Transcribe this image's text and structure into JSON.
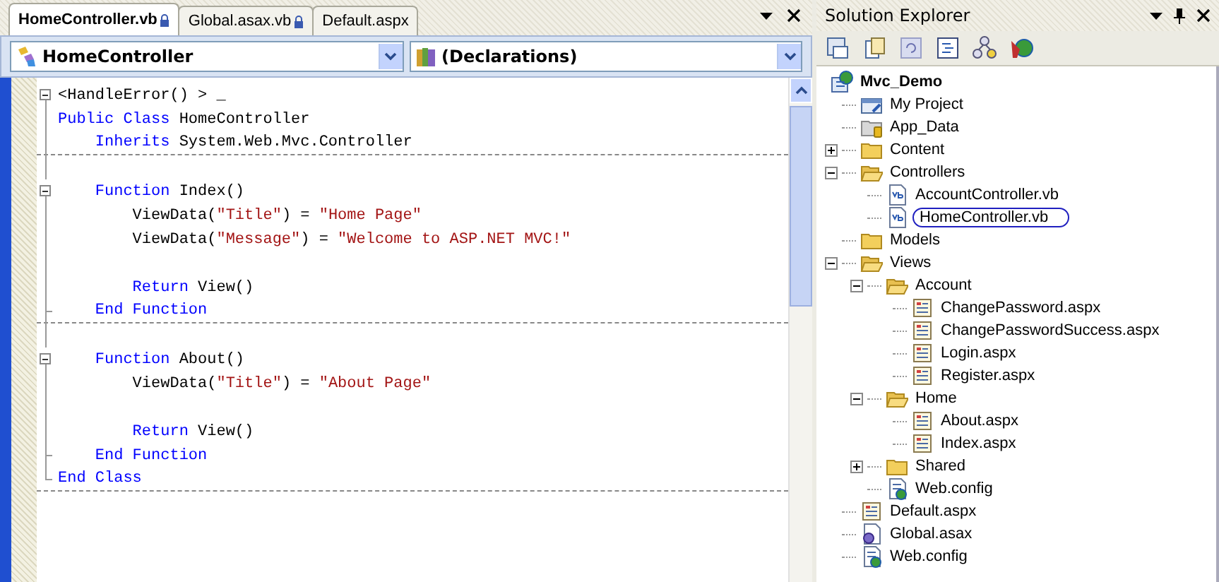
{
  "editor": {
    "tabs": [
      {
        "label": "HomeController.vb",
        "selected": true,
        "locked": true
      },
      {
        "label": "Global.asax.vb",
        "selected": false,
        "locked": true
      },
      {
        "label": "Default.aspx",
        "selected": false,
        "locked": false
      }
    ],
    "class_dropdown": {
      "value": "HomeController"
    },
    "member_dropdown": {
      "value": "(Declarations)"
    },
    "lines": [
      {
        "kind": "fold-start",
        "separator": false,
        "tokens": [
          {
            "kind": "plain",
            "text": "<HandleError() > _"
          }
        ]
      },
      {
        "kind": "fold-line",
        "separator": false,
        "tokens": [
          {
            "kind": "keyword",
            "text": "Public Class"
          },
          {
            "kind": "plain",
            "text": " HomeController"
          }
        ]
      },
      {
        "kind": "fold-line",
        "separator": true,
        "tokens": [
          {
            "kind": "keyword",
            "text": "    Inherits"
          },
          {
            "kind": "plain",
            "text": " System.Web.Mvc.Controller"
          }
        ]
      },
      {
        "kind": "fold-line"
      },
      {
        "kind": "fold-start",
        "separator": false,
        "tokens": [
          {
            "kind": "keyword",
            "text": "    Function"
          },
          {
            "kind": "plain",
            "text": " Index()"
          }
        ]
      },
      {
        "kind": "fold-line",
        "separator": false,
        "tokens": [
          {
            "kind": "plain",
            "text": "        ViewData("
          },
          {
            "kind": "string",
            "text": "\"Title\""
          },
          {
            "kind": "plain",
            "text": ") = "
          },
          {
            "kind": "string",
            "text": "\"Home Page\""
          }
        ]
      },
      {
        "kind": "fold-line",
        "separator": false,
        "tokens": [
          {
            "kind": "plain",
            "text": "        ViewData("
          },
          {
            "kind": "string",
            "text": "\"Message\""
          },
          {
            "kind": "plain",
            "text": ") = "
          },
          {
            "kind": "string",
            "text": "\"Welcome to ASP.NET MVC!\""
          }
        ]
      },
      {
        "kind": "fold-line"
      },
      {
        "kind": "fold-line",
        "separator": false,
        "tokens": [
          {
            "kind": "keyword",
            "text": "        Return"
          },
          {
            "kind": "plain",
            "text": " View()"
          }
        ]
      },
      {
        "kind": "fold-end",
        "separator": true,
        "tokens": [
          {
            "kind": "keyword",
            "text": "    End Function"
          }
        ]
      },
      {
        "kind": "fold-line"
      },
      {
        "kind": "fold-start",
        "separator": false,
        "tokens": [
          {
            "kind": "keyword",
            "text": "    Function"
          },
          {
            "kind": "plain",
            "text": " About()"
          }
        ]
      },
      {
        "kind": "fold-line",
        "separator": false,
        "tokens": [
          {
            "kind": "plain",
            "text": "        ViewData("
          },
          {
            "kind": "string",
            "text": "\"Title\""
          },
          {
            "kind": "plain",
            "text": ") = "
          },
          {
            "kind": "string",
            "text": "\"About Page\""
          }
        ]
      },
      {
        "kind": "fold-line"
      },
      {
        "kind": "fold-line",
        "separator": false,
        "tokens": [
          {
            "kind": "keyword",
            "text": "        Return"
          },
          {
            "kind": "plain",
            "text": " View()"
          }
        ]
      },
      {
        "kind": "fold-end",
        "separator": false,
        "tokens": [
          {
            "kind": "keyword",
            "text": "    End Function"
          }
        ]
      },
      {
        "kind": "fold-last",
        "separator": true,
        "tokens": [
          {
            "kind": "keyword",
            "text": "End Class"
          }
        ]
      }
    ]
  },
  "solution_explorer": {
    "title": "Solution Explorer",
    "tree": [
      {
        "label": "Mvc_Demo",
        "kind": "project",
        "selected": false,
        "children": [
          {
            "label": "My Project",
            "kind": "settings",
            "selected": false
          },
          {
            "label": "App_Data",
            "kind": "data",
            "selected": false
          },
          {
            "label": "Content",
            "kind": "folder",
            "expanded": false,
            "selected": false
          },
          {
            "label": "Controllers",
            "kind": "folder",
            "expanded": true,
            "selected": false,
            "children": [
              {
                "label": "AccountController.vb",
                "kind": "vb",
                "selected": false
              },
              {
                "label": "HomeController.vb",
                "kind": "vb",
                "selected": true
              }
            ]
          },
          {
            "label": "Models",
            "kind": "folder",
            "selected": false
          },
          {
            "label": "Views",
            "kind": "folder",
            "expanded": true,
            "selected": false,
            "children": [
              {
                "label": "Account",
                "kind": "folder",
                "expanded": true,
                "selected": false,
                "children": [
                  {
                    "label": "ChangePassword.aspx",
                    "kind": "page",
                    "selected": false
                  },
                  {
                    "label": "ChangePasswordSuccess.aspx",
                    "kind": "page",
                    "selected": false
                  },
                  {
                    "label": "Login.aspx",
                    "kind": "page",
                    "selected": false
                  },
                  {
                    "label": "Register.aspx",
                    "kind": "page",
                    "selected": false
                  }
                ]
              },
              {
                "label": "Home",
                "kind": "folder",
                "expanded": true,
                "selected": false,
                "children": [
                  {
                    "label": "About.aspx",
                    "kind": "page",
                    "selected": false
                  },
                  {
                    "label": "Index.aspx",
                    "kind": "page",
                    "selected": false
                  }
                ]
              },
              {
                "label": "Shared",
                "kind": "folder",
                "expanded": false,
                "selected": false
              },
              {
                "label": "Web.config",
                "kind": "config",
                "selected": false
              }
            ]
          },
          {
            "label": "Default.aspx",
            "kind": "page",
            "selected": false
          },
          {
            "label": "Global.asax",
            "kind": "global",
            "selected": false
          },
          {
            "label": "Web.config",
            "kind": "config",
            "selected": false
          }
        ]
      }
    ]
  }
}
